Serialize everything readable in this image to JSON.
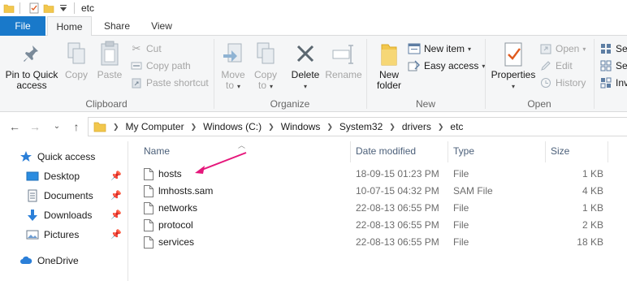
{
  "window": {
    "title": "etc"
  },
  "tabs": {
    "file": "File",
    "home": "Home",
    "share": "Share",
    "view": "View"
  },
  "ribbon": {
    "clipboard": {
      "label": "Clipboard",
      "pin_line1": "Pin to Quick",
      "pin_line2": "access",
      "copy": "Copy",
      "paste": "Paste",
      "cut": "Cut",
      "copy_path": "Copy path",
      "paste_shortcut": "Paste shortcut"
    },
    "organize": {
      "label": "Organize",
      "move_to_line1": "Move",
      "move_to_line2": "to",
      "copy_to_line1": "Copy",
      "copy_to_line2": "to",
      "delete": "Delete",
      "rename": "Rename"
    },
    "new": {
      "label": "New",
      "new_folder_line1": "New",
      "new_folder_line2": "folder",
      "new_item": "New item",
      "easy_access": "Easy access"
    },
    "open": {
      "label": "Open",
      "properties": "Properties",
      "open": "Open",
      "edit": "Edit",
      "history": "History"
    },
    "select": {
      "item1": "Sel",
      "item2": "Sel",
      "item3": "Inv"
    }
  },
  "address": {
    "crumbs": [
      "My Computer",
      "Windows (C:)",
      "Windows",
      "System32",
      "drivers",
      "etc"
    ]
  },
  "navpane": {
    "items": [
      {
        "label": "Quick access"
      },
      {
        "label": "Desktop"
      },
      {
        "label": "Documents"
      },
      {
        "label": "Downloads"
      },
      {
        "label": "Pictures"
      },
      {
        "label": "OneDrive"
      }
    ]
  },
  "columns": {
    "name": "Name",
    "date": "Date modified",
    "type": "Type",
    "size": "Size"
  },
  "files": [
    {
      "name": "hosts",
      "date": "18-09-15 01:23 PM",
      "type": "File",
      "size": "1 KB"
    },
    {
      "name": "lmhosts.sam",
      "date": "10-07-15 04:32 PM",
      "type": "SAM File",
      "size": "4 KB"
    },
    {
      "name": "networks",
      "date": "22-08-13 06:55 PM",
      "type": "File",
      "size": "1 KB"
    },
    {
      "name": "protocol",
      "date": "22-08-13 06:55 PM",
      "type": "File",
      "size": "2 KB"
    },
    {
      "name": "services",
      "date": "22-08-13 06:55 PM",
      "type": "File",
      "size": "18 KB"
    }
  ],
  "colors": {
    "accent": "#1979ca",
    "annotation_arrow": "#e5177b",
    "folder": "#f2c74d"
  }
}
